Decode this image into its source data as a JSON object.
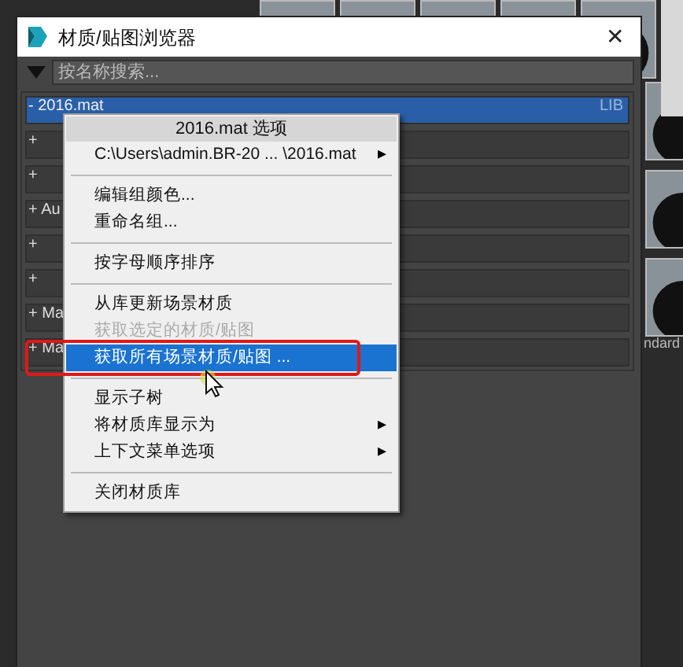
{
  "window": {
    "title": "材质/贴图浏览器",
    "close": "✕"
  },
  "search": {
    "placeholder": "按名称搜索..."
  },
  "groups": [
    {
      "label": "- 2016.mat",
      "tag": "LIB",
      "selected": true
    },
    {
      "label": "+",
      "selected": false
    },
    {
      "label": "+",
      "selected": false
    },
    {
      "label": "+ Au",
      "selected": false
    },
    {
      "label": "+",
      "selected": false
    },
    {
      "label": "+",
      "selected": false
    },
    {
      "label": "+ Ma",
      "selected": false
    },
    {
      "label": "+ Ma",
      "selected": false
    }
  ],
  "context_menu": {
    "title": "2016.mat 选项",
    "items": [
      {
        "kind": "item",
        "label": "C:\\Users\\admin.BR-20 ... \\2016.mat",
        "submenu": "▸",
        "disabled": false,
        "selected": false
      },
      {
        "kind": "separator"
      },
      {
        "kind": "item",
        "label": "编辑组颜色...",
        "disabled": false,
        "selected": false
      },
      {
        "kind": "item",
        "label": "重命名组...",
        "disabled": false,
        "selected": false
      },
      {
        "kind": "separator"
      },
      {
        "kind": "item",
        "label": "按字母顺序排序",
        "disabled": false,
        "selected": false
      },
      {
        "kind": "separator"
      },
      {
        "kind": "item",
        "label": "从库更新场景材质",
        "disabled": false,
        "selected": false
      },
      {
        "kind": "item",
        "label": "获取选定的材质/贴图",
        "disabled": true,
        "selected": false
      },
      {
        "kind": "item",
        "label": "获取所有场景材质/贴图 ...",
        "disabled": false,
        "selected": true
      },
      {
        "kind": "separator"
      },
      {
        "kind": "item",
        "label": "显示子树",
        "disabled": false,
        "selected": false
      },
      {
        "kind": "item",
        "label": "将材质库显示为",
        "submenu": "▸",
        "disabled": false,
        "selected": false
      },
      {
        "kind": "item",
        "label": "上下文菜单选项",
        "submenu": "▸",
        "disabled": false,
        "selected": false
      },
      {
        "kind": "separator"
      },
      {
        "kind": "item",
        "label": "关闭材质库",
        "disabled": false,
        "selected": false
      }
    ]
  },
  "side_panel": {
    "label": "ndard"
  }
}
